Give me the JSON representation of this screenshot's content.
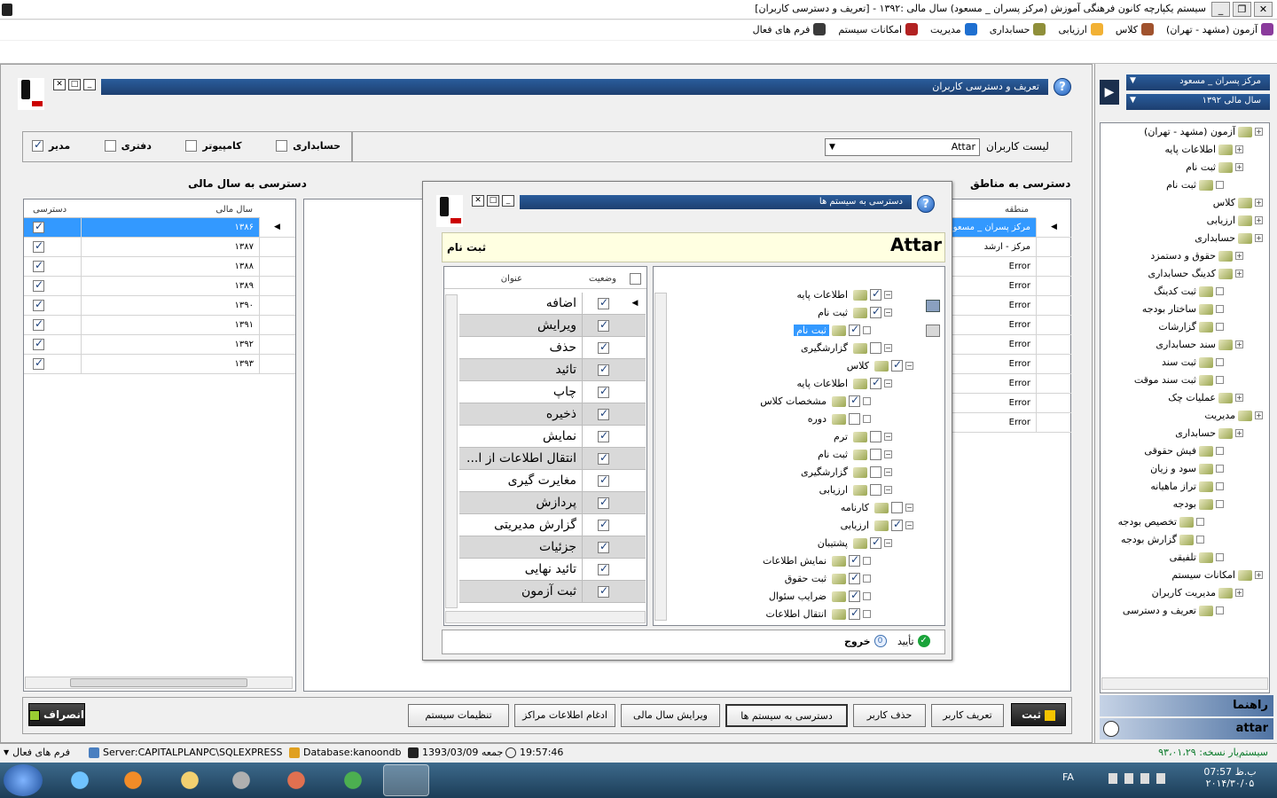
{
  "window": {
    "title": "سیستم یکپارچه کانون فرهنگی آموزش  (مرکز پسران _ مسعود) سال مالی :۱۳۹۲ - [تعریف و دسترسی کاربران]",
    "btn_close": "✕",
    "btn_max": "❐",
    "btn_min": "_"
  },
  "menu": {
    "items": [
      {
        "label": "آزمون (مشهد - تهران)",
        "icon": "exam-icon",
        "color": "#8a3b9c"
      },
      {
        "label": "کلاس",
        "icon": "class-icon",
        "color": "#a0522d"
      },
      {
        "label": "ارزیابی",
        "icon": "evaluation-icon",
        "color": "#f2b134"
      },
      {
        "label": "حسابداری",
        "icon": "accounting-icon",
        "color": "#8f8f3a"
      },
      {
        "label": "مدیریت",
        "icon": "management-icon",
        "color": "#1e6fd0"
      },
      {
        "label": "امکانات سیستم",
        "icon": "system-tools-icon",
        "color": "#b22222"
      },
      {
        "label": "فرم های فعال",
        "icon": "active-forms-icon",
        "color": "#3a3a3a"
      }
    ]
  },
  "user_form": {
    "title": "تعریف و دسترسی کاربران",
    "help": "?",
    "roles": [
      {
        "label": "حسابداری",
        "checked": false
      },
      {
        "label": "کامپیوتر",
        "checked": false
      },
      {
        "label": "دفتری",
        "checked": false
      },
      {
        "label": "مدیر",
        "checked": true
      }
    ],
    "user_list_label": "لیست کاربران",
    "user_list_value": "Attar",
    "fiscal_section_title": "دسترسی به سال مالی",
    "fiscal_headers": {
      "year": "سال مالی",
      "access": "دسترسی"
    },
    "fiscal_rows": [
      {
        "year": "۱۳۸۶",
        "access": true
      },
      {
        "year": "۱۳۸۷",
        "access": true
      },
      {
        "year": "۱۳۸۸",
        "access": true
      },
      {
        "year": "۱۳۸۹",
        "access": true
      },
      {
        "year": "۱۳۹۰",
        "access": true
      },
      {
        "year": "۱۳۹۱",
        "access": true
      },
      {
        "year": "۱۳۹۲",
        "access": true
      },
      {
        "year": "۱۳۹۳",
        "access": true
      }
    ],
    "region_section_title": "دسترسی به مناطق",
    "region_header": "منطقه",
    "region_rows": [
      "مرکز پسران _ مسعود",
      "مرکز - ارشد",
      "Error",
      "Error",
      "Error",
      "Error",
      "Error",
      "Error",
      "Error",
      "Error",
      "Error"
    ],
    "buttons": {
      "save": "ثبت",
      "define_user": "تعریف کاربر",
      "delete_user": "حذف کاربر",
      "system_access": "دسترسی به سیستم ها",
      "edit_fiscal": "ویرایش سال مالی",
      "merge_centers": "ادغام اطلاعات مراکز",
      "system_settings": "تنظیمات سیستم",
      "cancel": "انصراف"
    }
  },
  "dialog": {
    "title": "دسترسی به سیستم ها",
    "user": "Attar",
    "selected_node": "ثبت نام",
    "perm_headers": {
      "status": "وضعیت",
      "title": "عنوان"
    },
    "permissions": [
      {
        "title": "اضافه",
        "on": true
      },
      {
        "title": "ویرایش",
        "on": true
      },
      {
        "title": "حذف",
        "on": true
      },
      {
        "title": "تائید",
        "on": true
      },
      {
        "title": "چاپ",
        "on": true
      },
      {
        "title": "ذخیره",
        "on": true
      },
      {
        "title": "نمایش",
        "on": true
      },
      {
        "title": "انتقال اطلاعات از ا...",
        "on": true
      },
      {
        "title": "مغایرت گیری",
        "on": true
      },
      {
        "title": "پردازش",
        "on": true
      },
      {
        "title": "گزارش مدیریتی",
        "on": true
      },
      {
        "title": "جزئیات",
        "on": true
      },
      {
        "title": "تائید نهایی",
        "on": true
      },
      {
        "title": "ثبت آزمون",
        "on": true
      }
    ],
    "tree": [
      {
        "label": "اطلاعات پایه",
        "on": true,
        "level": 0
      },
      {
        "label": "ثبت نام",
        "on": true,
        "level": 0
      },
      {
        "label": "ثبت نام",
        "on": true,
        "level": 1,
        "selected": true
      },
      {
        "label": "گزارشگیری",
        "on": false,
        "level": 0
      },
      {
        "label": "کلاس",
        "on": true,
        "level": -1
      },
      {
        "label": "اطلاعات پایه",
        "on": true,
        "level": 0
      },
      {
        "label": "مشخصات کلاس",
        "on": true,
        "level": 1
      },
      {
        "label": "دوره",
        "on": false,
        "level": 1
      },
      {
        "label": "ترم",
        "on": false,
        "level": 0
      },
      {
        "label": "ثبت نام",
        "on": false,
        "level": 0
      },
      {
        "label": "گزارشگیری",
        "on": false,
        "level": 0
      },
      {
        "label": "ارزیابی",
        "on": false,
        "level": 0
      },
      {
        "label": "کارنامه",
        "on": false,
        "level": -1
      },
      {
        "label": "ارزیابی",
        "on": true,
        "level": -1
      },
      {
        "label": "پشتیبان",
        "on": true,
        "level": 0
      },
      {
        "label": "نمایش اطلاعات",
        "on": true,
        "level": 1
      },
      {
        "label": "ثبت حقوق",
        "on": true,
        "level": 1
      },
      {
        "label": "ضرایب سئوال",
        "on": true,
        "level": 1
      },
      {
        "label": "انتقال اطلاعات",
        "on": true,
        "level": 1
      }
    ],
    "confirm": "تأیید",
    "exit": "خروج"
  },
  "sidebar": {
    "center": "مرکز پسران _ مسعود",
    "fiscal_year": "سال مالی ۱۳۹۲",
    "tree": [
      {
        "label": "آزمون (مشهد - تهران)",
        "x": 0
      },
      {
        "label": "اطلاعات پایه",
        "x": 1
      },
      {
        "label": "ثبت نام",
        "x": 1
      },
      {
        "label": "ثبت نام",
        "x": 2
      },
      {
        "label": "کلاس",
        "x": 0
      },
      {
        "label": "ارزیابی",
        "x": 0
      },
      {
        "label": "حسابداری",
        "x": 0
      },
      {
        "label": "حقوق و دستمزد",
        "x": 1
      },
      {
        "label": "کدینگ حسابداری",
        "x": 1
      },
      {
        "label": "ثبت کدینگ",
        "x": 2
      },
      {
        "label": "ساختار بودجه",
        "x": 2
      },
      {
        "label": "گزارشات",
        "x": 2
      },
      {
        "label": "سند حسابداری",
        "x": 1
      },
      {
        "label": "ثبت سند",
        "x": 2
      },
      {
        "label": "ثبت سند موقت",
        "x": 2
      },
      {
        "label": "عملیات چک",
        "x": 1
      },
      {
        "label": "مدیریت",
        "x": 0
      },
      {
        "label": "حسابداری",
        "x": 1
      },
      {
        "label": "فیش حقوقی",
        "x": 2
      },
      {
        "label": "سود و زیان",
        "x": 2
      },
      {
        "label": "تراز ماهیانه",
        "x": 2
      },
      {
        "label": "بودجه",
        "x": 2
      },
      {
        "label": "تخصیص بودجه",
        "x": 3
      },
      {
        "label": "گزارش بودجه",
        "x": 3
      },
      {
        "label": "تلفیقی",
        "x": 2
      },
      {
        "label": "امکانات سیستم",
        "x": 0
      },
      {
        "label": "مدیریت کاربران",
        "x": 1
      },
      {
        "label": "تعریف و دسترسی",
        "x": 2
      }
    ],
    "help_label": "راهنما",
    "user_name": "attar",
    "version": "سیستم‌یار نسخه: ۹۳،۰۱،۲۹"
  },
  "statusbar": {
    "active_forms": "فرم های فعال",
    "server": "Server:CAPITALPLANPC\\SQLEXPRESS",
    "database": "Database:kanoondb",
    "date": "1393/03/09 جمعه",
    "time": "19:57:46"
  },
  "taskbar": {
    "lang": "FA",
    "clock_time": "07:57 ب.ظ",
    "clock_date": "۲۰۱۴/۳۰/۰۵"
  }
}
